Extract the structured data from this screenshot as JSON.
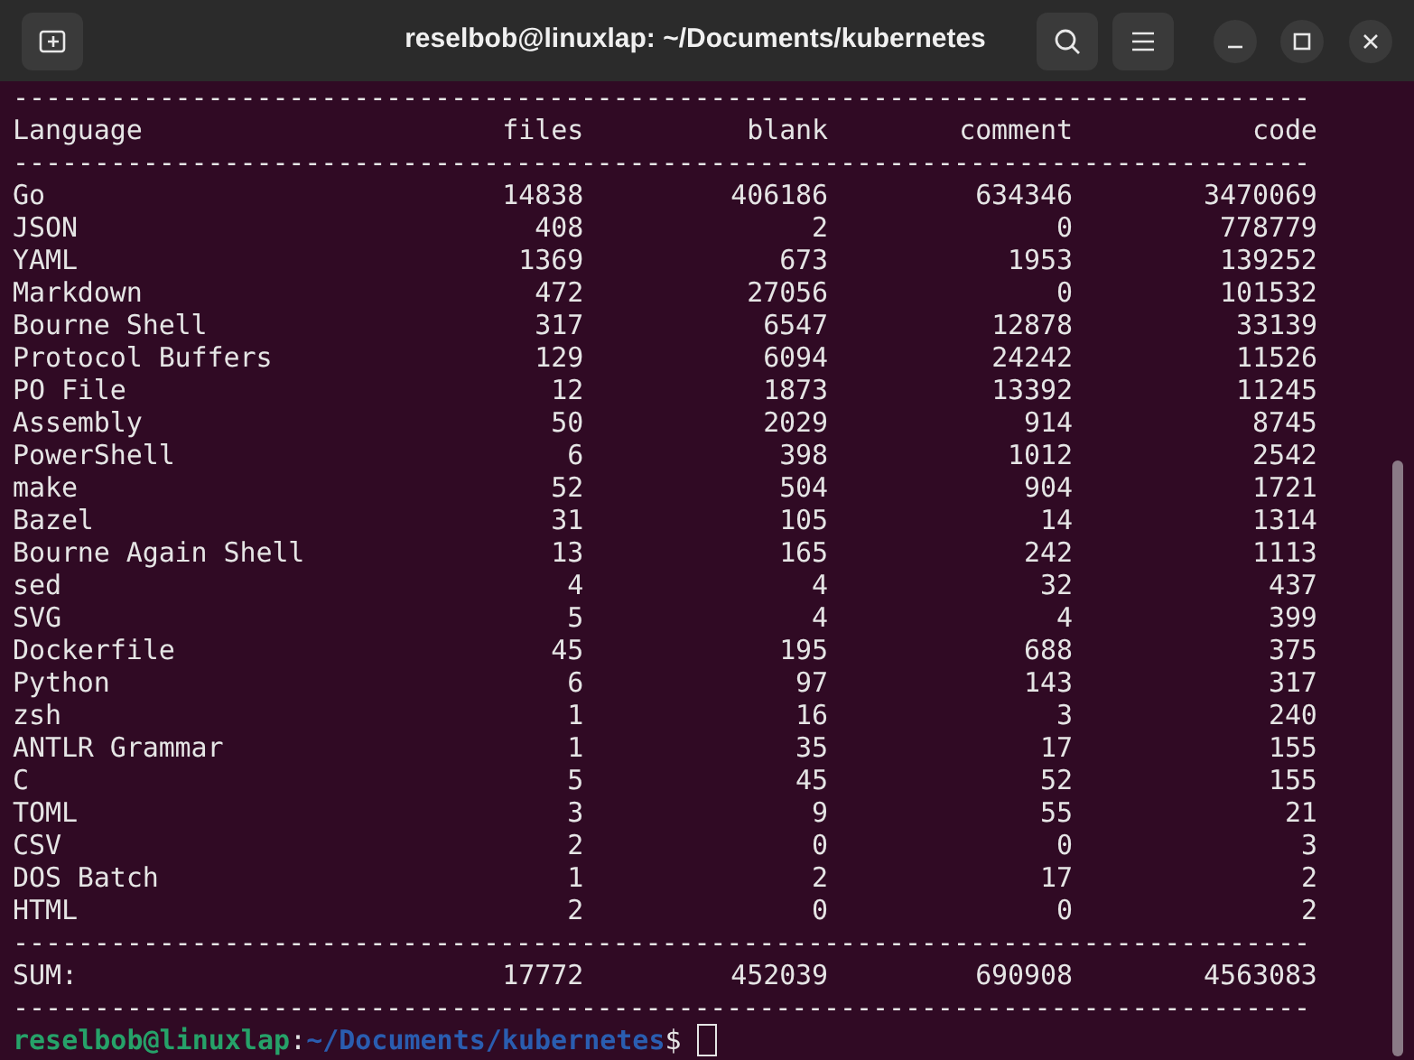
{
  "window": {
    "title": "reselbob@linuxlap: ~/Documents/kubernetes"
  },
  "terminal": {
    "lines": [
      {
        "kind": "rule",
        "text": "--------------------------------------------------------------------------------"
      },
      {
        "kind": "row",
        "cells": [
          "Language",
          "files",
          "blank",
          "comment",
          "code"
        ]
      },
      {
        "kind": "rule",
        "text": "--------------------------------------------------------------------------------"
      },
      {
        "kind": "row",
        "cells": [
          "Go",
          "14838",
          "406186",
          "634346",
          "3470069"
        ]
      },
      {
        "kind": "row",
        "cells": [
          "JSON",
          "408",
          "2",
          "0",
          "778779"
        ]
      },
      {
        "kind": "row",
        "cells": [
          "YAML",
          "1369",
          "673",
          "1953",
          "139252"
        ]
      },
      {
        "kind": "row",
        "cells": [
          "Markdown",
          "472",
          "27056",
          "0",
          "101532"
        ]
      },
      {
        "kind": "row",
        "cells": [
          "Bourne Shell",
          "317",
          "6547",
          "12878",
          "33139"
        ]
      },
      {
        "kind": "row",
        "cells": [
          "Protocol Buffers",
          "129",
          "6094",
          "24242",
          "11526"
        ]
      },
      {
        "kind": "row",
        "cells": [
          "PO File",
          "12",
          "1873",
          "13392",
          "11245"
        ]
      },
      {
        "kind": "row",
        "cells": [
          "Assembly",
          "50",
          "2029",
          "914",
          "8745"
        ]
      },
      {
        "kind": "row",
        "cells": [
          "PowerShell",
          "6",
          "398",
          "1012",
          "2542"
        ]
      },
      {
        "kind": "row",
        "cells": [
          "make",
          "52",
          "504",
          "904",
          "1721"
        ]
      },
      {
        "kind": "row",
        "cells": [
          "Bazel",
          "31",
          "105",
          "14",
          "1314"
        ]
      },
      {
        "kind": "row",
        "cells": [
          "Bourne Again Shell",
          "13",
          "165",
          "242",
          "1113"
        ]
      },
      {
        "kind": "row",
        "cells": [
          "sed",
          "4",
          "4",
          "32",
          "437"
        ]
      },
      {
        "kind": "row",
        "cells": [
          "SVG",
          "5",
          "4",
          "4",
          "399"
        ]
      },
      {
        "kind": "row",
        "cells": [
          "Dockerfile",
          "45",
          "195",
          "688",
          "375"
        ]
      },
      {
        "kind": "row",
        "cells": [
          "Python",
          "6",
          "97",
          "143",
          "317"
        ]
      },
      {
        "kind": "row",
        "cells": [
          "zsh",
          "1",
          "16",
          "3",
          "240"
        ]
      },
      {
        "kind": "row",
        "cells": [
          "ANTLR Grammar",
          "1",
          "35",
          "17",
          "155"
        ]
      },
      {
        "kind": "row",
        "cells": [
          "C",
          "5",
          "45",
          "52",
          "155"
        ]
      },
      {
        "kind": "row",
        "cells": [
          "TOML",
          "3",
          "9",
          "55",
          "21"
        ]
      },
      {
        "kind": "row",
        "cells": [
          "CSV",
          "2",
          "0",
          "0",
          "3"
        ]
      },
      {
        "kind": "row",
        "cells": [
          "DOS Batch",
          "1",
          "2",
          "17",
          "2"
        ]
      },
      {
        "kind": "row",
        "cells": [
          "HTML",
          "2",
          "0",
          "0",
          "2"
        ]
      },
      {
        "kind": "rule",
        "text": "--------------------------------------------------------------------------------"
      },
      {
        "kind": "row",
        "cells": [
          "SUM:",
          "17772",
          "452039",
          "690908",
          "4563083"
        ]
      },
      {
        "kind": "rule",
        "text": "--------------------------------------------------------------------------------"
      }
    ],
    "prompt": {
      "user_host": "reselbob@linuxlap",
      "colon": ":",
      "path": "~/Documents/kubernetes",
      "symbol": "$"
    }
  }
}
